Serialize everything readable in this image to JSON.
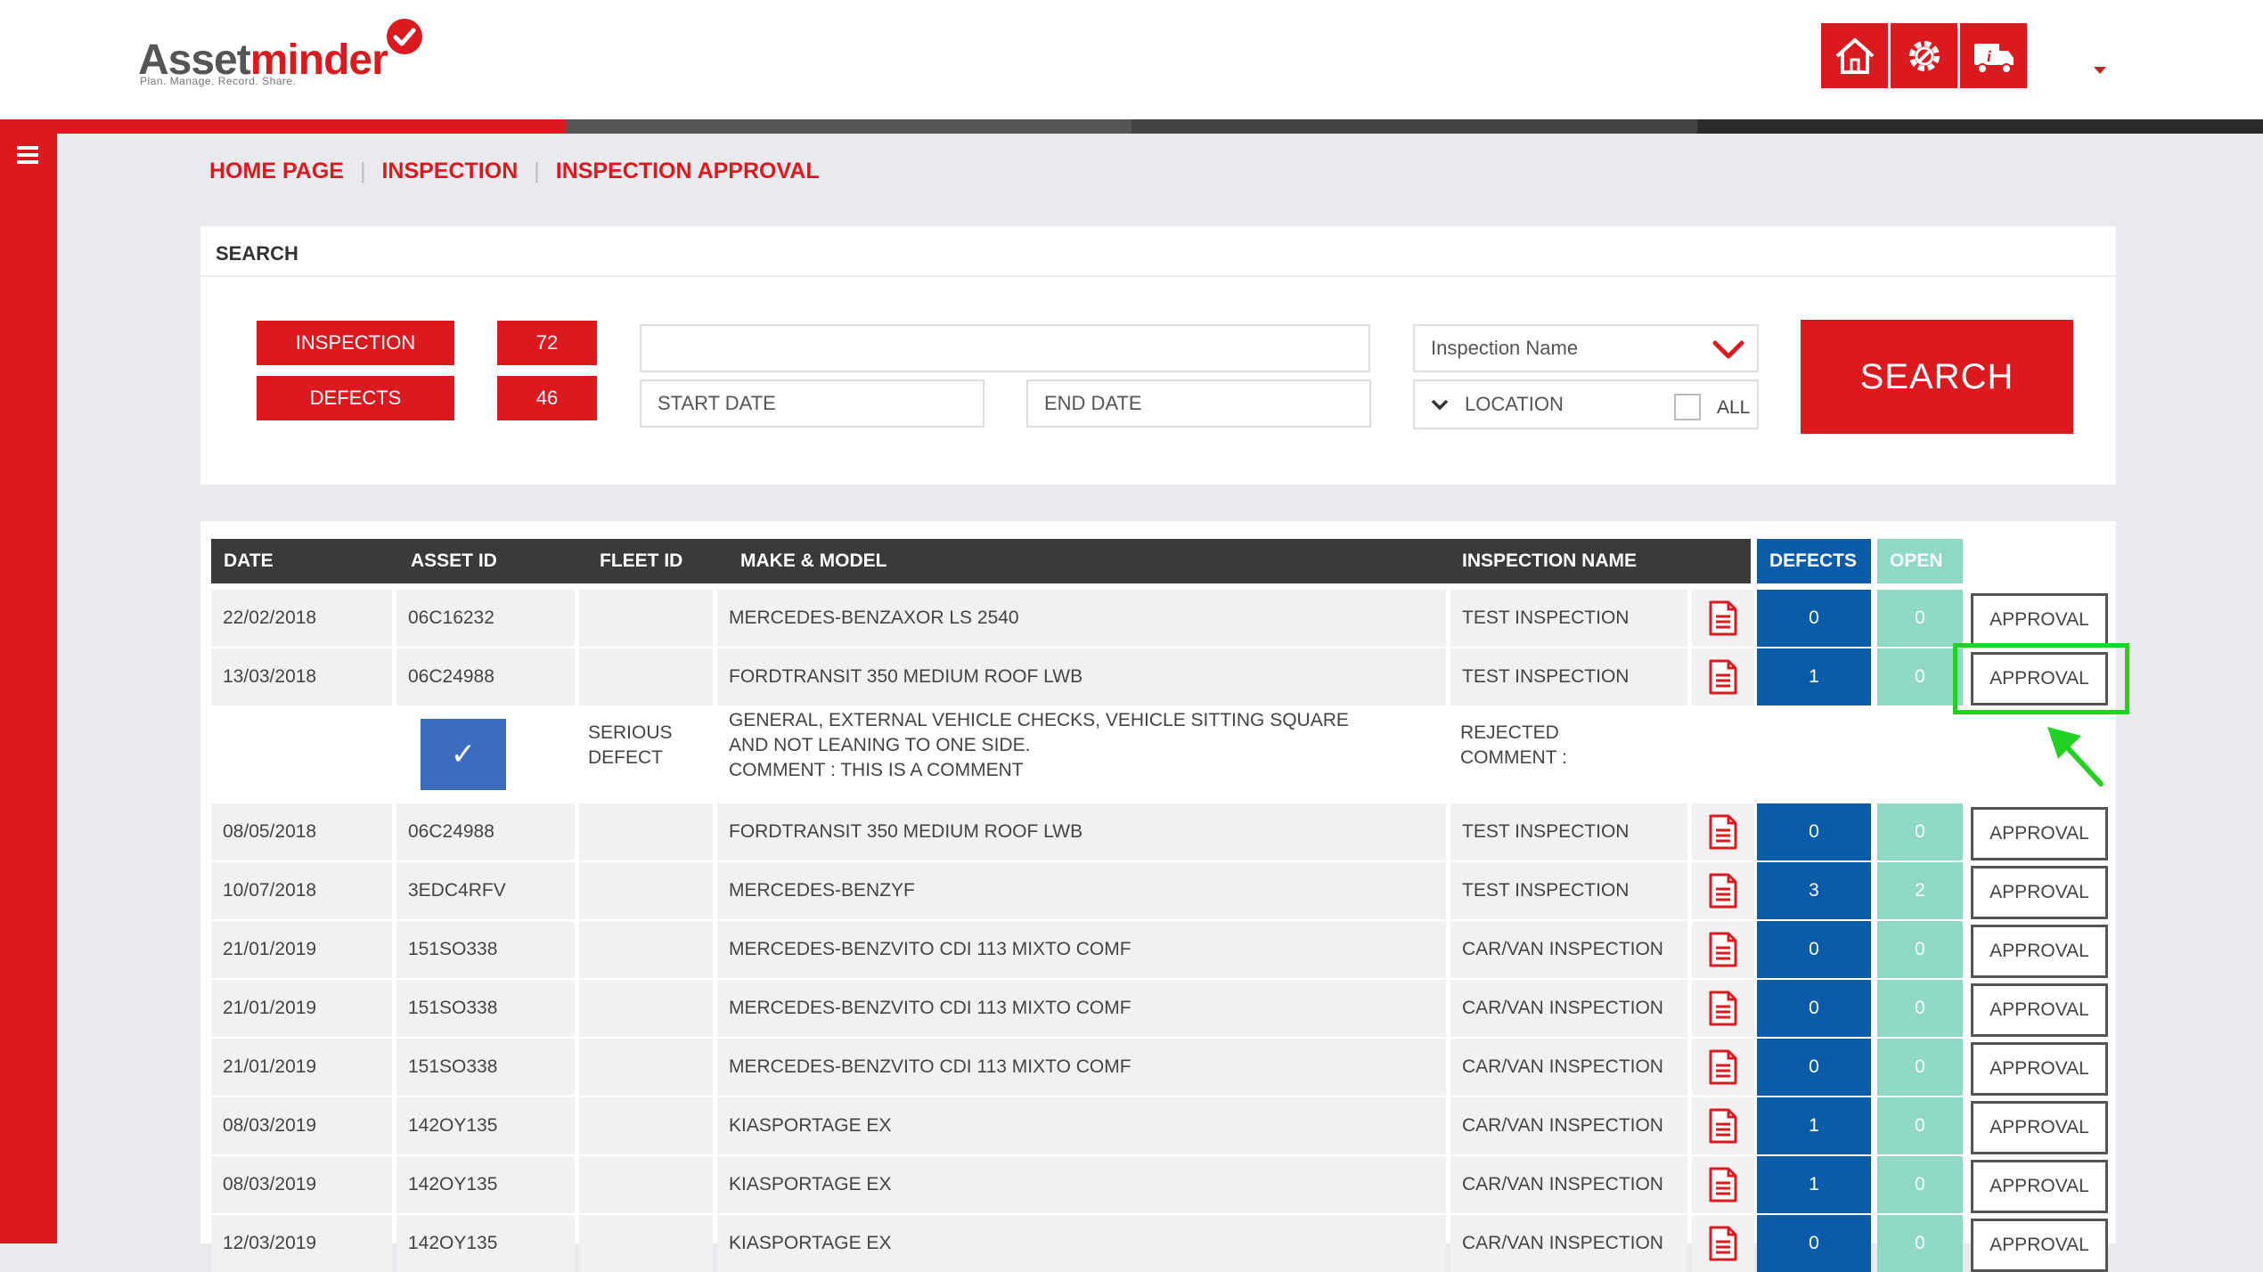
{
  "app": {
    "logo_part1": "Asset",
    "logo_part2": "minder",
    "tagline": "Plan. Manage. Record. Share."
  },
  "header_icons": [
    "home-icon",
    "gear-wrench-icon",
    "truck-info-icon"
  ],
  "colors": {
    "brand_red": "#db1a1f",
    "defects_blue": "#0a5ca8",
    "open_teal": "#8ed8c4",
    "header_dark": "#3a3a3a",
    "highlight_green": "#22d122",
    "progress_segments": [
      "#db1a1f",
      "#555555",
      "#444444",
      "#2b2b2b"
    ]
  },
  "breadcrumb": {
    "items": [
      "HOME PAGE",
      "INSPECTION",
      "INSPECTION APPROVAL"
    ],
    "separator": "|"
  },
  "search": {
    "title": "SEARCH",
    "inspection_label": "INSPECTION",
    "inspection_count": "72",
    "defects_label": "DEFECTS",
    "defects_count": "46",
    "text_value": "",
    "start_date_placeholder": "START DATE",
    "end_date_placeholder": "END DATE",
    "inspection_name_select": "Inspection Name",
    "location_label": "LOCATION",
    "all_label": "ALL",
    "search_button": "SEARCH"
  },
  "table": {
    "headers": {
      "date": "DATE",
      "asset_id": "ASSET ID",
      "fleet_id": "FLEET ID",
      "make_model": "MAKE & MODEL",
      "inspection_name": "INSPECTION NAME",
      "defects": "DEFECTS",
      "open": "OPEN"
    },
    "approval_label": "APPROVAL",
    "rows": [
      {
        "date": "22/02/2018",
        "asset_id": "06C16232",
        "fleet_id": "",
        "make_model": "MERCEDES-BENZAXOR LS 2540",
        "inspection_name": "TEST INSPECTION",
        "defects": "0",
        "open": "0"
      },
      {
        "date": "13/03/2018",
        "asset_id": "06C24988",
        "fleet_id": "",
        "make_model": "FORDTRANSIT 350 MEDIUM ROOF LWB",
        "inspection_name": "TEST INSPECTION",
        "defects": "1",
        "open": "0"
      },
      {
        "date": "08/05/2018",
        "asset_id": "06C24988",
        "fleet_id": "",
        "make_model": "FORDTRANSIT 350 MEDIUM ROOF LWB",
        "inspection_name": "TEST INSPECTION",
        "defects": "0",
        "open": "0"
      },
      {
        "date": "10/07/2018",
        "asset_id": "3EDC4RFV",
        "fleet_id": "",
        "make_model": "MERCEDES-BENZYF",
        "inspection_name": "TEST INSPECTION",
        "defects": "3",
        "open": "2"
      },
      {
        "date": "21/01/2019",
        "asset_id": "151SO338",
        "fleet_id": "",
        "make_model": "MERCEDES-BENZVITO CDI 113 MIXTO COMF",
        "inspection_name": "CAR/VAN INSPECTION",
        "defects": "0",
        "open": "0"
      },
      {
        "date": "21/01/2019",
        "asset_id": "151SO338",
        "fleet_id": "",
        "make_model": "MERCEDES-BENZVITO CDI 113 MIXTO COMF",
        "inspection_name": "CAR/VAN INSPECTION",
        "defects": "0",
        "open": "0"
      },
      {
        "date": "21/01/2019",
        "asset_id": "151SO338",
        "fleet_id": "",
        "make_model": "MERCEDES-BENZVITO CDI 113 MIXTO COMF",
        "inspection_name": "CAR/VAN INSPECTION",
        "defects": "0",
        "open": "0"
      },
      {
        "date": "08/03/2019",
        "asset_id": "142OY135",
        "fleet_id": "",
        "make_model": "KIASPORTAGE EX",
        "inspection_name": "CAR/VAN INSPECTION",
        "defects": "1",
        "open": "0"
      },
      {
        "date": "08/03/2019",
        "asset_id": "142OY135",
        "fleet_id": "",
        "make_model": "KIASPORTAGE EX",
        "inspection_name": "CAR/VAN INSPECTION",
        "defects": "1",
        "open": "0"
      },
      {
        "date": "12/03/2019",
        "asset_id": "142OY135",
        "fleet_id": "",
        "make_model": "KIASPORTAGE EX",
        "inspection_name": "CAR/VAN INSPECTION",
        "defects": "0",
        "open": "0"
      }
    ],
    "defect_detail": {
      "check_mark": "✓",
      "severity_line1": "SERIOUS",
      "severity_line2": "DEFECT",
      "description_line1": "GENERAL, EXTERNAL VEHICLE CHECKS, VEHICLE SITTING SQUARE",
      "description_line2": "AND NOT LEANING TO ONE SIDE.",
      "comment_line": "COMMENT : THIS IS A COMMENT",
      "rejected_line1": "REJECTED",
      "rejected_line2": "COMMENT :"
    }
  }
}
